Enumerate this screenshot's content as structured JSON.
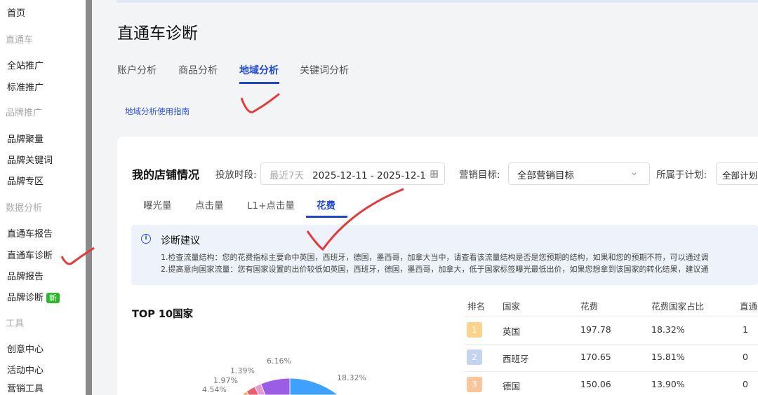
{
  "sidebar": {
    "items": [
      {
        "label": "首页",
        "type": "item"
      },
      {
        "label": "直通车",
        "type": "group"
      },
      {
        "label": "全站推广",
        "type": "item"
      },
      {
        "label": "标准推广",
        "type": "item"
      },
      {
        "label": "品牌推广",
        "type": "group"
      },
      {
        "label": "品牌聚量",
        "type": "item"
      },
      {
        "label": "品牌关键词",
        "type": "item"
      },
      {
        "label": "品牌专区",
        "type": "item"
      },
      {
        "label": "数据分析",
        "type": "group"
      },
      {
        "label": "直通车报告",
        "type": "item"
      },
      {
        "label": "直通车诊断",
        "type": "item"
      },
      {
        "label": "品牌报告",
        "type": "item"
      },
      {
        "label": "品牌诊断",
        "type": "item"
      },
      {
        "label": "工具",
        "type": "group"
      },
      {
        "label": "创意中心",
        "type": "item"
      },
      {
        "label": "活动中心",
        "type": "item"
      },
      {
        "label": "营销工具",
        "type": "item"
      }
    ],
    "new_badge": "新"
  },
  "page": {
    "title": "直通车诊断",
    "tabs": [
      "账户分析",
      "商品分析",
      "地域分析",
      "关键词分析"
    ],
    "active_tab": 2,
    "guide_link": "地域分析使用指南"
  },
  "store": {
    "title": "我的店铺情况",
    "period_label": "投放时段:",
    "period_placeholder": "最近7天",
    "period_value": "2025-12-11 - 2025-12-1",
    "goal_label": "营销目标:",
    "goal_value": "全部营销目标",
    "plan_label": "所属于计划:",
    "plan_value": "全部计划"
  },
  "metric_tabs": [
    "曝光量",
    "点击量",
    "L1+点击量",
    "花费"
  ],
  "advice": {
    "title": "诊断建议",
    "lines": [
      "1.检查流量结构：您的花费指标主要命中英国，西班牙，德国，墨西哥，加拿大当中，请查看该流量结构是否是您预期的结构，如果和您的预期不符，可以通过调",
      "2.提高意向国家流量：您有国家设置的出价较低如英国，西班牙，德国，墨西哥，加拿大，低于国家标签曝光最低出价，如果您想拿到该国家的转化结果，建议通"
    ]
  },
  "top10": {
    "title": "TOP 10国家"
  },
  "table": {
    "headers": [
      "排名",
      "国家",
      "花费",
      "花费国家占比",
      "直通"
    ],
    "rows": [
      {
        "rank": "1",
        "country": "英国",
        "cost": "197.78",
        "share": "18.32%",
        "extra": "1",
        "color": "#fbd38d"
      },
      {
        "rank": "2",
        "country": "西班牙",
        "cost": "170.65",
        "share": "15.81%",
        "extra": "0",
        "color": "#c3d3f0"
      },
      {
        "rank": "3",
        "country": "德国",
        "cost": "150.06",
        "share": "13.90%",
        "extra": "0",
        "color": "#fbc49a"
      }
    ]
  },
  "chart_data": {
    "type": "pie",
    "title": "TOP 10国家",
    "slices": [
      {
        "label": "18.32%",
        "value": 18.32,
        "color": "#3ea0ff",
        "dir": 1
      },
      {
        "label": "6.16%",
        "value": 6.16,
        "color": "#9b5de5",
        "dir": -1
      },
      {
        "label": "1.39%",
        "value": 1.39,
        "color": "#e59ad6",
        "dir": -1
      },
      {
        "label": "1.97%",
        "value": 1.97,
        "color": "#ee5d6c",
        "dir": -1
      },
      {
        "label": "4.54%",
        "value": 4.54,
        "color": "#f4a261",
        "dir": -1
      }
    ]
  }
}
